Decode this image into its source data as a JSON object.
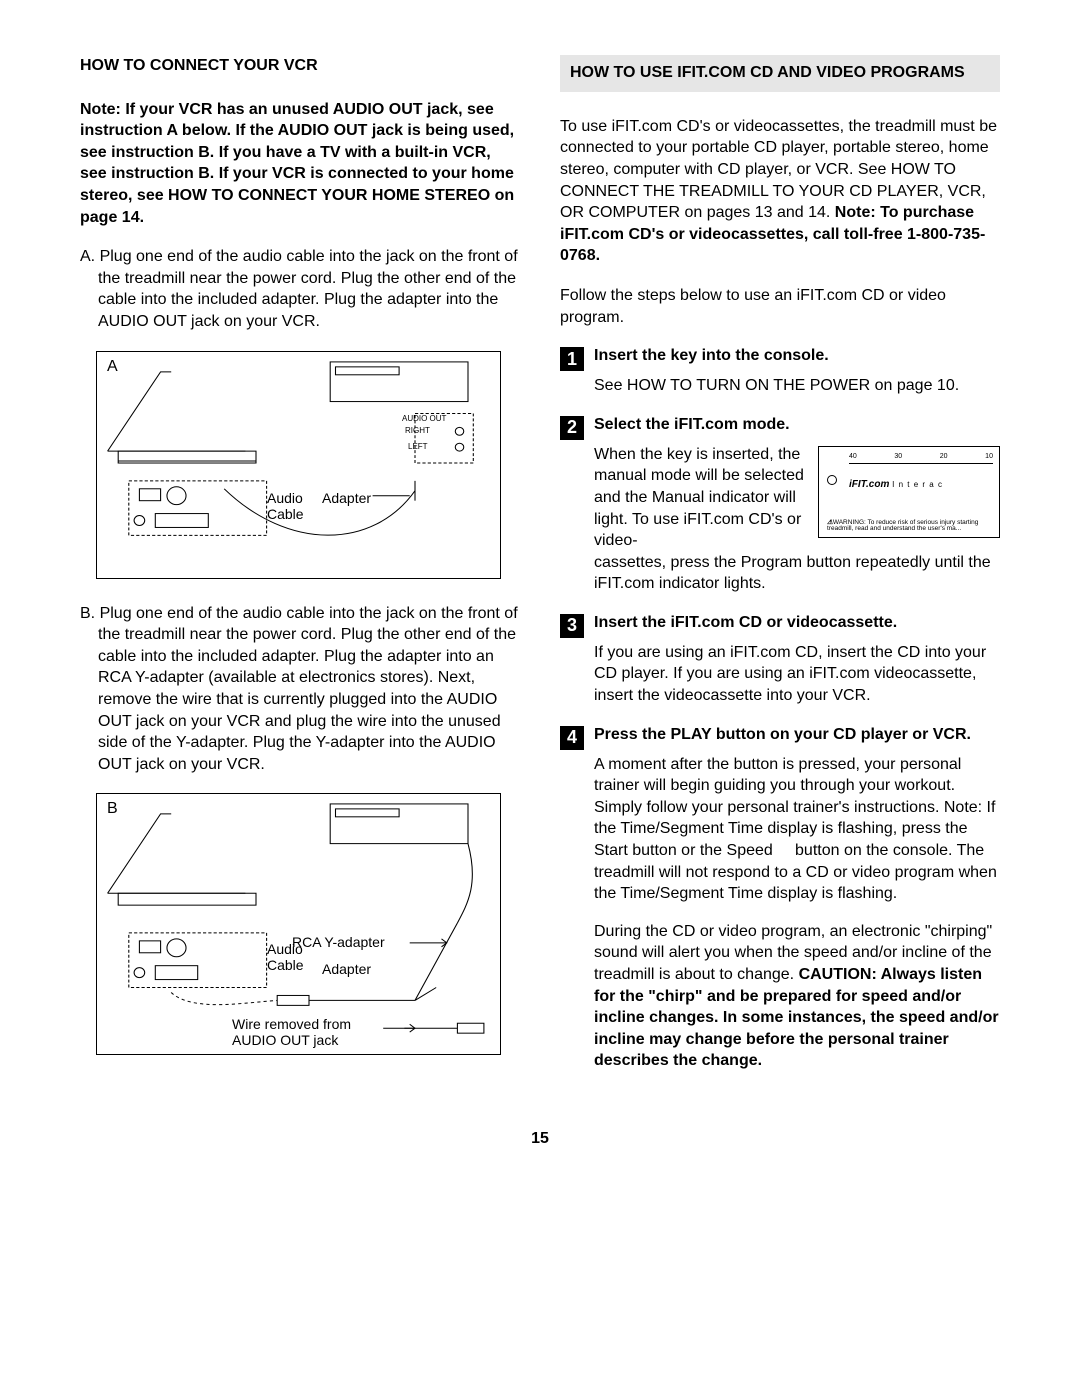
{
  "left": {
    "heading": "HOW TO CONNECT YOUR VCR",
    "note": "Note: If your VCR has an unused AUDIO OUT jack, see instruction A below. If the AUDIO OUT jack is being used, see instruction B. If you have a TV with a built-in VCR, see instruction B. If your VCR is connected to your home stereo, see HOW TO CONNECT YOUR HOME STEREO on page 14.",
    "stepA": "A. Plug one end of the audio cable into the jack on the front of the treadmill near the power cord. Plug the other end of the cable into the included adapter. Plug the adapter into the AUDIO OUT jack on your VCR.",
    "figA": {
      "label": "A",
      "audio_cable": "Audio\nCable",
      "adapter": "Adapter",
      "audio_out": "AUDIO OUT",
      "right": "RIGHT",
      "left_lbl": "LEFT"
    },
    "stepB": "B. Plug one end of the audio cable into the jack on the front of the treadmill near the power cord. Plug the other end of the cable into the included adapter. Plug the adapter into an RCA Y-adapter (available at electronics stores). Next, remove the wire that is currently plugged into the AUDIO OUT jack on your VCR and plug the wire into the unused side of the Y-adapter. Plug the Y-adapter into the AUDIO OUT jack on your VCR.",
    "figB": {
      "label": "B",
      "audio_cable": "Audio\nCable",
      "adapter": "Adapter",
      "rca": "RCA Y-adapter",
      "wire": "Wire removed from\nAUDIO OUT jack"
    }
  },
  "right": {
    "heading": "HOW TO USE IFIT.COM CD AND VIDEO PROGRAMS",
    "intro_plain": "To use iFIT.com CD's or videocassettes, the treadmill must be connected to your portable CD player, portable stereo, home stereo, computer with CD player, or VCR. See HOW TO CONNECT THE TREADMILL TO YOUR CD PLAYER, VCR, OR COMPUTER on pages 13 and 14. ",
    "intro_bold": "Note: To purchase iFIT.com CD's or videocassettes, call toll-free 1-800-735-0768.",
    "follow": "Follow the steps below to use an iFIT.com CD or video program.",
    "step1_title": "Insert the key into the console.",
    "step1_body": "See HOW TO TURN ON THE POWER on page 10.",
    "step2_title": "Select the iFIT.com mode.",
    "step2_body_a": "When the key is inserted, the manual mode will be selected and the Manual indicator will light. To use iFIT.com CD's or video-",
    "step2_body_b": "cassettes, press the Program button repeatedly until the iFIT.com indicator lights.",
    "step3_title": "Insert the iFIT.com CD or videocassette.",
    "step3_body": "If you are using an iFIT.com CD, insert the CD into your CD player. If you are using an iFIT.com videocassette, insert the videocassette into your VCR.",
    "step4_title": "Press the PLAY button on your CD player or VCR.",
    "step4_body1": "A moment after the button is pressed, your personal trainer will begin guiding you through your workout. Simply follow your personal trainer's instructions. Note: If the Time/Segment Time display is flashing, press the Start button or the Speed     button on the console. The treadmill will not respond to a CD or video program when the Time/Segment Time display is flashing.",
    "step4_body2_plain": "During the CD or video program, an electronic \"chirping\" sound will alert you when the speed and/or incline of the treadmill is about to change. ",
    "step4_body2_bold": "CAUTION: Always listen for the \"chirp\" and be prepared for speed and/or incline changes. In some instances, the speed and/or incline may change before the personal trainer describes the change.",
    "console": {
      "brand": "iFIT.com",
      "interac": "I n t e r a c",
      "scale": [
        "40",
        "30",
        "20",
        "10"
      ],
      "warning": "WARNING: To reduce risk of serious injury starting treadmill, read and understand the user's ma..."
    }
  },
  "page_number": "15"
}
